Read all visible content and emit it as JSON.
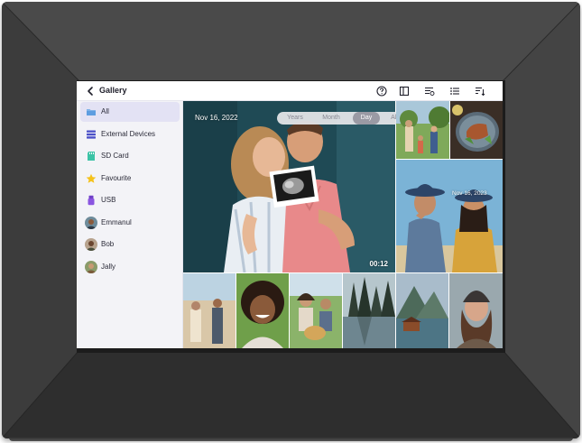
{
  "app": {
    "title": "Gallery"
  },
  "toolbar": {
    "icons": [
      "back-icon",
      "help-icon",
      "layout-icon",
      "slideshow-settings-icon",
      "list-view-icon",
      "sort-icon"
    ]
  },
  "sidebar": {
    "items": [
      {
        "label": "All",
        "icon": "folder-icon",
        "active": true
      },
      {
        "label": "External Devices",
        "icon": "stack-icon",
        "active": false
      },
      {
        "label": "SD Card",
        "icon": "sd-card-icon",
        "active": false
      },
      {
        "label": "Favourite",
        "icon": "star-icon",
        "active": false
      },
      {
        "label": "USB",
        "icon": "usb-icon",
        "active": false
      },
      {
        "label": "Emmanul",
        "icon": "avatar",
        "active": false
      },
      {
        "label": "Bob",
        "icon": "avatar",
        "active": false
      },
      {
        "label": "Jally",
        "icon": "avatar",
        "active": false
      }
    ]
  },
  "view_switch": {
    "options": [
      "Years",
      "Month",
      "Day",
      "All"
    ],
    "selected": "Day"
  },
  "gallery": {
    "main": {
      "date": "Nov 16, 2022",
      "duration": "00:12"
    },
    "featured_side": {
      "date": "Nov 16, 2023"
    }
  },
  "colors": {
    "frame": "#3a3a3a",
    "sidebar_bg": "#f3f3f7",
    "active_item": "#e3e2f4",
    "segment_selected": "#9a9aa4",
    "text_dark": "#1e1e2a"
  }
}
